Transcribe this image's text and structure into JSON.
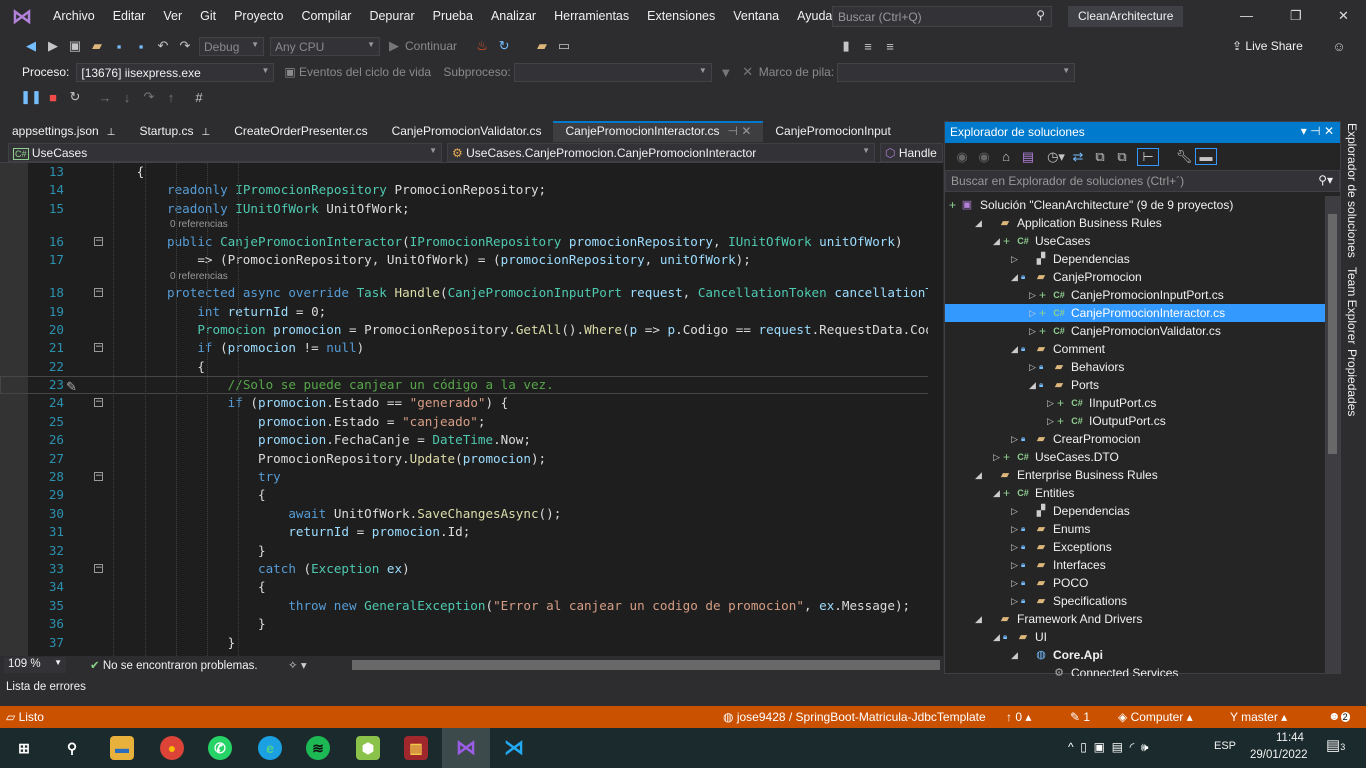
{
  "menu": {
    "items": [
      "Archivo",
      "Editar",
      "Ver",
      "Git",
      "Proyecto",
      "Compilar",
      "Depurar",
      "Prueba",
      "Analizar",
      "Herramientas",
      "Extensiones",
      "Ventana",
      "Ayuda"
    ],
    "search_placeholder": "Buscar (Ctrl+Q)",
    "project_name": "CleanArchitecture"
  },
  "toolbar": {
    "config": "Debug",
    "platform": "Any CPU",
    "continue": "Continuar",
    "live_share": "Live Share"
  },
  "debug_bar": {
    "process_label": "Proceso:",
    "process_value": "[13676] iisexpress.exe",
    "lifecycle": "Eventos del ciclo de vida",
    "thread_label": "Subproceso:",
    "stack_label": "Marco de pila:"
  },
  "tabs": [
    {
      "label": "appsettings.json",
      "pinned": true
    },
    {
      "label": "Startup.cs",
      "pinned": true
    },
    {
      "label": "CreateOrderPresenter.cs"
    },
    {
      "label": "CanjePromocionValidator.cs"
    },
    {
      "label": "CanjePromocionInteractor.cs",
      "active": true
    },
    {
      "label": "CanjePromocionInput"
    }
  ],
  "nav": {
    "project": "UseCases",
    "type": "UseCases.CanjePromocion.CanjePromocionInteractor",
    "member": "Handle"
  },
  "code": [
    {
      "n": "13",
      "tk": [
        [
          "        {",
          "v"
        ]
      ]
    },
    {
      "n": "14",
      "tk": [
        [
          "            ",
          "v"
        ],
        [
          "readonly ",
          "k"
        ],
        [
          "IPromocionRepository",
          "t"
        ],
        [
          " PromocionRepository;",
          "v"
        ]
      ]
    },
    {
      "n": "15",
      "tk": [
        [
          "            ",
          "v"
        ],
        [
          "readonly ",
          "k"
        ],
        [
          "IUnitOfWork",
          "t"
        ],
        [
          " UnitOfWork;",
          "v"
        ]
      ]
    },
    {
      "lens": "0 referencias"
    },
    {
      "n": "16",
      "fold": true,
      "tk": [
        [
          "            ",
          "v"
        ],
        [
          "public ",
          "k"
        ],
        [
          "CanjePromocionInteractor",
          "t"
        ],
        [
          "(",
          "v"
        ],
        [
          "IPromocionRepository",
          "t"
        ],
        [
          " ",
          "v"
        ],
        [
          "promocionRepository",
          "p"
        ],
        [
          ", ",
          "v"
        ],
        [
          "IUnitOfWork",
          "t"
        ],
        [
          " ",
          "v"
        ],
        [
          "unitOfWork",
          "p"
        ],
        [
          ")",
          "v"
        ]
      ]
    },
    {
      "n": "17",
      "tk": [
        [
          "                => (PromocionRepository, UnitOfWork) = (",
          "v"
        ],
        [
          "promocionRepository",
          "p"
        ],
        [
          ", ",
          "v"
        ],
        [
          "unitOfWork",
          "p"
        ],
        [
          ");",
          "v"
        ]
      ]
    },
    {
      "lens": "0 referencias"
    },
    {
      "n": "18",
      "fold": true,
      "tk": [
        [
          "            ",
          "v"
        ],
        [
          "protected async override ",
          "k"
        ],
        [
          "Task",
          "t"
        ],
        [
          " ",
          "v"
        ],
        [
          "Handle",
          "m"
        ],
        [
          "(",
          "v"
        ],
        [
          "CanjePromocionInputPort",
          "t"
        ],
        [
          " ",
          "v"
        ],
        [
          "request",
          "p"
        ],
        [
          ", ",
          "v"
        ],
        [
          "CancellationToken",
          "t"
        ],
        [
          " ",
          "v"
        ],
        [
          "cancellationToken",
          "p"
        ]
      ]
    },
    {
      "n": "19",
      "tk": [
        [
          "                ",
          "v"
        ],
        [
          "int ",
          "k"
        ],
        [
          "returnId",
          "p"
        ],
        [
          " = 0;",
          "v"
        ]
      ]
    },
    {
      "n": "20",
      "tk": [
        [
          "                ",
          "v"
        ],
        [
          "Promocion",
          "t"
        ],
        [
          " ",
          "v"
        ],
        [
          "promocion",
          "p"
        ],
        [
          " = PromocionRepository.",
          "v"
        ],
        [
          "GetAll",
          "m"
        ],
        [
          "().",
          "v"
        ],
        [
          "Where",
          "m"
        ],
        [
          "(",
          "v"
        ],
        [
          "p",
          "p"
        ],
        [
          " => ",
          "v"
        ],
        [
          "p",
          "p"
        ],
        [
          ".Codigo == ",
          "v"
        ],
        [
          "request",
          "p"
        ],
        [
          ".RequestData.Codigo",
          "v"
        ]
      ]
    },
    {
      "n": "21",
      "fold": true,
      "tk": [
        [
          "                ",
          "v"
        ],
        [
          "if ",
          "k"
        ],
        [
          "(",
          "v"
        ],
        [
          "promocion",
          "p"
        ],
        [
          " != ",
          "v"
        ],
        [
          "null",
          "k"
        ],
        [
          ")",
          "v"
        ]
      ]
    },
    {
      "n": "22",
      "tk": [
        [
          "                {",
          "v"
        ]
      ]
    },
    {
      "n": "23",
      "current": true,
      "tk": [
        [
          "                    ",
          "v"
        ],
        [
          "//Solo se puede canjear un código a la vez.",
          "c"
        ]
      ]
    },
    {
      "n": "24",
      "fold": true,
      "tk": [
        [
          "                    ",
          "v"
        ],
        [
          "if ",
          "k"
        ],
        [
          "(",
          "v"
        ],
        [
          "promocion",
          "p"
        ],
        [
          ".Estado == ",
          "v"
        ],
        [
          "\"generado\"",
          "s"
        ],
        [
          ") {",
          "v"
        ]
      ]
    },
    {
      "n": "25",
      "tk": [
        [
          "                        ",
          "v"
        ],
        [
          "promocion",
          "p"
        ],
        [
          ".Estado = ",
          "v"
        ],
        [
          "\"canjeado\"",
          "s"
        ],
        [
          ";",
          "v"
        ]
      ]
    },
    {
      "n": "26",
      "tk": [
        [
          "                        ",
          "v"
        ],
        [
          "promocion",
          "p"
        ],
        [
          ".FechaCanje = ",
          "v"
        ],
        [
          "DateTime",
          "t"
        ],
        [
          ".Now;",
          "v"
        ]
      ]
    },
    {
      "n": "27",
      "tk": [
        [
          "                        PromocionRepository.",
          "v"
        ],
        [
          "Update",
          "m"
        ],
        [
          "(",
          "v"
        ],
        [
          "promocion",
          "p"
        ],
        [
          ");",
          "v"
        ]
      ]
    },
    {
      "n": "28",
      "fold": true,
      "tk": [
        [
          "                        ",
          "v"
        ],
        [
          "try",
          "k"
        ]
      ]
    },
    {
      "n": "29",
      "tk": [
        [
          "                        {",
          "v"
        ]
      ]
    },
    {
      "n": "30",
      "tk": [
        [
          "                            ",
          "v"
        ],
        [
          "await ",
          "k"
        ],
        [
          "UnitOfWork.",
          "v"
        ],
        [
          "SaveChangesAsync",
          "m"
        ],
        [
          "();",
          "v"
        ]
      ]
    },
    {
      "n": "31",
      "tk": [
        [
          "                            ",
          "v"
        ],
        [
          "returnId",
          "p"
        ],
        [
          " = ",
          "v"
        ],
        [
          "promocion",
          "p"
        ],
        [
          ".Id;",
          "v"
        ]
      ]
    },
    {
      "n": "32",
      "tk": [
        [
          "                        }",
          "v"
        ]
      ]
    },
    {
      "n": "33",
      "fold": true,
      "tk": [
        [
          "                        ",
          "v"
        ],
        [
          "catch ",
          "k"
        ],
        [
          "(",
          "v"
        ],
        [
          "Exception",
          "t"
        ],
        [
          " ",
          "v"
        ],
        [
          "ex",
          "p"
        ],
        [
          ")",
          "v"
        ]
      ]
    },
    {
      "n": "34",
      "tk": [
        [
          "                        {",
          "v"
        ]
      ]
    },
    {
      "n": "35",
      "tk": [
        [
          "                            ",
          "v"
        ],
        [
          "throw new ",
          "k"
        ],
        [
          "GeneralException",
          "t"
        ],
        [
          "(",
          "v"
        ],
        [
          "\"Error al canjear un codigo de promocion\"",
          "s"
        ],
        [
          ", ",
          "v"
        ],
        [
          "ex",
          "p"
        ],
        [
          ".Message);",
          "v"
        ]
      ]
    },
    {
      "n": "36",
      "tk": [
        [
          "                        }",
          "v"
        ]
      ]
    },
    {
      "n": "37",
      "tk": [
        [
          "                    }",
          "v"
        ]
      ]
    }
  ],
  "editor_status": {
    "zoom": "109 %",
    "problems": "No se encontraron problemas."
  },
  "solution_explorer": {
    "title": "Explorador de soluciones",
    "search_placeholder": "Buscar en Explorador de soluciones (Ctrl+´)",
    "nodes": [
      {
        "label": "Solución \"CleanArchitecture\" (9 de 9 proyectos)",
        "lvl": 0,
        "icon": "solution",
        "exp": ""
      },
      {
        "label": "Application Business Rules",
        "lvl": 1,
        "icon": "folder",
        "exp": "open"
      },
      {
        "label": "UseCases",
        "lvl": 2,
        "icon": "csproj",
        "exp": "open"
      },
      {
        "label": "Dependencias",
        "lvl": 3,
        "icon": "deps",
        "exp": "closed"
      },
      {
        "label": "CanjePromocion",
        "lvl": 3,
        "icon": "folder",
        "exp": "open"
      },
      {
        "label": "CanjePromocionInputPort.cs",
        "lvl": 4,
        "icon": "cs",
        "exp": "closed"
      },
      {
        "label": "CanjePromocionInteractor.cs",
        "lvl": 4,
        "icon": "cs",
        "exp": "closed",
        "selected": true
      },
      {
        "label": "CanjePromocionValidator.cs",
        "lvl": 4,
        "icon": "cs",
        "exp": "closed"
      },
      {
        "label": "Comment",
        "lvl": 3,
        "icon": "folder",
        "exp": "open"
      },
      {
        "label": "Behaviors",
        "lvl": 4,
        "icon": "folder",
        "exp": "closed"
      },
      {
        "label": "Ports",
        "lvl": 4,
        "icon": "folder",
        "exp": "open"
      },
      {
        "label": "IInputPort.cs",
        "lvl": 5,
        "icon": "cs",
        "exp": "closed"
      },
      {
        "label": "IOutputPort.cs",
        "lvl": 5,
        "icon": "cs",
        "exp": "closed"
      },
      {
        "label": "CrearPromocion",
        "lvl": 3,
        "icon": "folder",
        "exp": "closed"
      },
      {
        "label": "UseCases.DTO",
        "lvl": 2,
        "icon": "csproj",
        "exp": "closed"
      },
      {
        "label": "Enterprise Business Rules",
        "lvl": 1,
        "icon": "folder",
        "exp": "open"
      },
      {
        "label": "Entities",
        "lvl": 2,
        "icon": "csproj",
        "exp": "open"
      },
      {
        "label": "Dependencias",
        "lvl": 3,
        "icon": "deps",
        "exp": "closed"
      },
      {
        "label": "Enums",
        "lvl": 3,
        "icon": "folder",
        "exp": "closed"
      },
      {
        "label": "Exceptions",
        "lvl": 3,
        "icon": "folder",
        "exp": "closed"
      },
      {
        "label": "Interfaces",
        "lvl": 3,
        "icon": "folder",
        "exp": "closed"
      },
      {
        "label": "POCO",
        "lvl": 3,
        "icon": "folder",
        "exp": "closed"
      },
      {
        "label": "Specifications",
        "lvl": 3,
        "icon": "folder",
        "exp": "closed"
      },
      {
        "label": "Framework And Drivers",
        "lvl": 1,
        "icon": "folder",
        "exp": "open"
      },
      {
        "label": "UI",
        "lvl": 2,
        "icon": "folder",
        "exp": "open"
      },
      {
        "label": "Core.Api",
        "lvl": 3,
        "icon": "web",
        "exp": "open",
        "bold": true
      },
      {
        "label": "Connected Services",
        "lvl": 4,
        "icon": "service",
        "exp": ""
      }
    ]
  },
  "side_tabs": [
    "Explorador de soluciones",
    "Team Explorer",
    "Propiedades"
  ],
  "error_list_tab": "Lista de errores",
  "status_bar": {
    "ready": "Listo",
    "repo": "jose9428 / SpringBoot-Matricula-JdbcTemplate",
    "push": "0",
    "changes": "1",
    "computer": "Computer",
    "branch": "master",
    "notifications": "2"
  },
  "taskbar": {
    "time": "11:44",
    "date": "29/01/2022",
    "lang": "ESP",
    "notif_count": "3"
  },
  "colors": {
    "accent": "#007acc",
    "status": "#ca5100",
    "selection": "#3399ff"
  }
}
